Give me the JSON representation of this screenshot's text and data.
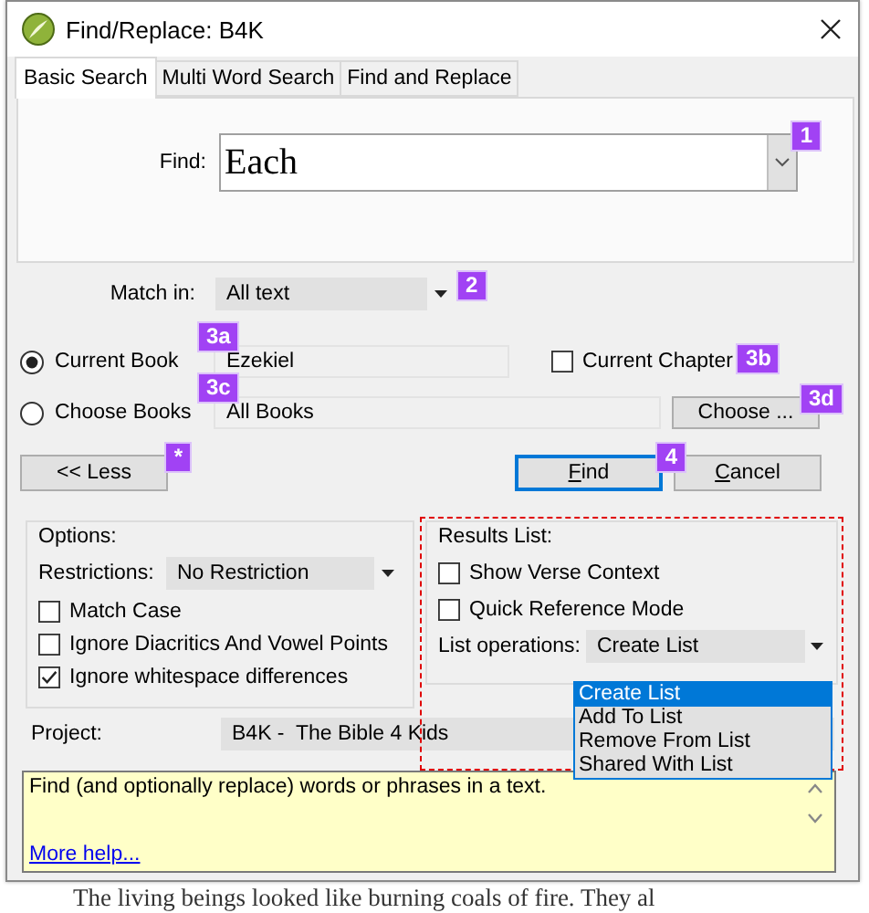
{
  "window": {
    "title": "Find/Replace: B4K"
  },
  "tabs": [
    {
      "label": "Basic Search",
      "selected": true
    },
    {
      "label": "Multi Word Search",
      "selected": false
    },
    {
      "label": "Find and Replace",
      "selected": false
    }
  ],
  "find": {
    "label": "Find:",
    "value": "Each",
    "annotation": "1"
  },
  "match_in": {
    "label": "Match in:",
    "value": "All text",
    "annotation": "2"
  },
  "scope": [
    {
      "label": "Current Book",
      "selected": true,
      "value": "Ezekiel",
      "annotation": "3a"
    },
    {
      "label": "Choose Books",
      "selected": false,
      "value": "All Books",
      "annotation": "3c"
    }
  ],
  "current_chapter": {
    "label": "Current Chapter",
    "checked": false,
    "annotation": "3b"
  },
  "choose_button": {
    "label": "Choose ...",
    "annotation": "3d"
  },
  "buttons": [
    {
      "label": "<< Less",
      "kind": "plain",
      "mnemonic": false,
      "annotation": "*"
    },
    {
      "label": "Find",
      "kind": "default",
      "mnemonic": true,
      "annotation": "4"
    },
    {
      "label": "Cancel",
      "kind": "plain",
      "mnemonic": true
    }
  ],
  "options": {
    "title": "Options:",
    "restrictions": {
      "label": "Restrictions:",
      "value": "No Restriction"
    },
    "checkboxes": [
      {
        "label": "Match Case",
        "checked": false
      },
      {
        "label": "Ignore Diacritics And Vowel Points",
        "checked": false
      },
      {
        "label": "Ignore whitespace differences",
        "checked": true
      }
    ]
  },
  "results_list": {
    "title": "Results List:",
    "checkboxes": [
      {
        "label": "Show Verse Context",
        "checked": false
      },
      {
        "label": "Quick Reference Mode",
        "checked": false
      }
    ],
    "list_operations": {
      "label": "List operations:",
      "value": "Create List",
      "expanded": true,
      "options": [
        {
          "label": "Create List",
          "selected": true
        },
        {
          "label": "Add To List",
          "selected": false
        },
        {
          "label": "Remove From List",
          "selected": false
        },
        {
          "label": "Shared With List",
          "selected": false
        }
      ]
    }
  },
  "project": {
    "label": "Project:",
    "value": "B4K -  The Bible 4 Kids"
  },
  "help": {
    "text": "Find (and optionally replace) words or phrases in a text.",
    "link": "More help..."
  },
  "background_text": "The living beings looked like burning coals of fire. They al"
}
